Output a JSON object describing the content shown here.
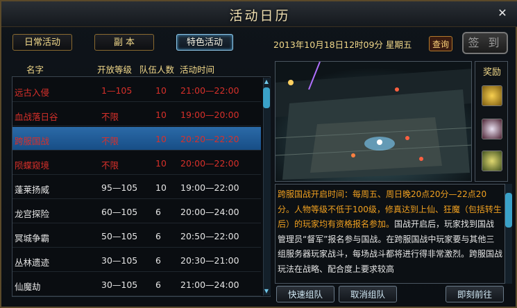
{
  "window": {
    "title": "活动日历"
  },
  "tabs": [
    {
      "label": "日常活动"
    },
    {
      "label": "副 本"
    },
    {
      "label": "特色活动"
    }
  ],
  "datetime": "2013年10月18日12时09分 星期五",
  "query_label": "查询",
  "checkin_label": "签 到",
  "table": {
    "headers": [
      "名字",
      "开放等级",
      "队伍人数",
      "活动时间"
    ],
    "rows": [
      {
        "name": "远古入侵",
        "level": "1—105",
        "team": "10",
        "time": "21:00—22:00",
        "style": "red"
      },
      {
        "name": "血战落日谷",
        "level": "不限",
        "team": "10",
        "time": "19:00—20:00",
        "style": "red"
      },
      {
        "name": "跨服国战",
        "level": "不限",
        "team": "10",
        "time": "20:20—22:20",
        "style": "sel"
      },
      {
        "name": "陨蝶窥境",
        "level": "不限",
        "team": "10",
        "time": "20:00—22:00",
        "style": "red"
      },
      {
        "name": "蓬莱扬威",
        "level": "95—105",
        "team": "10",
        "time": "19:00—22:00",
        "style": "white"
      },
      {
        "name": "龙宫探险",
        "level": "60—105",
        "team": "6",
        "time": "20:00—24:00",
        "style": "white"
      },
      {
        "name": "冥城争霸",
        "level": "50—105",
        "team": "6",
        "time": "20:50—22:00",
        "style": "white"
      },
      {
        "name": "丛林遗迹",
        "level": "30—105",
        "team": "6",
        "time": "20:30—21:00",
        "style": "white"
      },
      {
        "name": "仙魔劫",
        "level": "30—105",
        "team": "6",
        "time": "21:00—24:00",
        "style": "white"
      }
    ]
  },
  "reward_title": "奖励",
  "description": {
    "highlight": "跨服国战开启时间：每周五、周日晚20点20分—22点20分。人物等级不低于100级，修真达到上仙、狂魔（包括转生后）的玩家均有资格报名参加。",
    "body": "国战开启后，玩家找到国战管理员“督军”报名参与国战。在跨服国战中玩家要与其他三组服务器玩家战斗，每场战斗都将进行得非常激烈。跨服国战玩法在战略、配合度上要求较高"
  },
  "buttons": {
    "quick_team": "快速组队",
    "cancel_team": "取消组队",
    "go_now": "即刻前往"
  },
  "colors": {
    "gold": "#f2d98a",
    "red": "#d8302a",
    "orange": "#f0a020",
    "selected_row": "#1f5b95"
  }
}
